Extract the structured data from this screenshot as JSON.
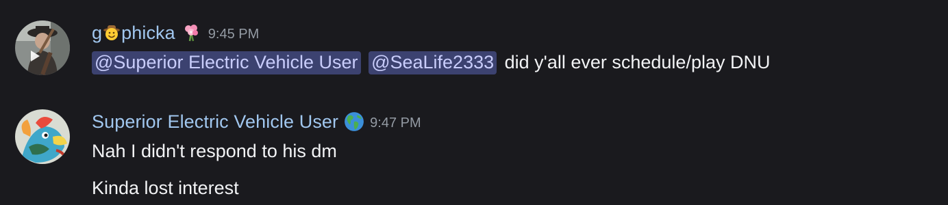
{
  "messages": [
    {
      "author": {
        "name_prefix": "g",
        "name_emoji": "cowboy-smile-emoji",
        "name_suffix": "phicka",
        "role_icon": "flower-bouquet-icon",
        "color": "#a1c7ef"
      },
      "timestamp": "9:45 PM",
      "content": {
        "mentions": [
          "@Superior Electric Vehicle User",
          "@SeaLife2333"
        ],
        "text": "did y'all ever schedule/play DNU"
      }
    },
    {
      "author": {
        "name": "Superior Electric Vehicle User",
        "role_icon": "globe-americas-icon",
        "color": "#a1c7ef"
      },
      "timestamp": "9:47 PM",
      "lines": [
        "Nah I didn't respond to his dm",
        "Kinda lost interest"
      ]
    }
  ],
  "theme": {
    "background": "#1a1a1e",
    "mention_bg": "#3c4270",
    "mention_fg": "#c9cdfb",
    "timestamp": "#949ba4"
  }
}
